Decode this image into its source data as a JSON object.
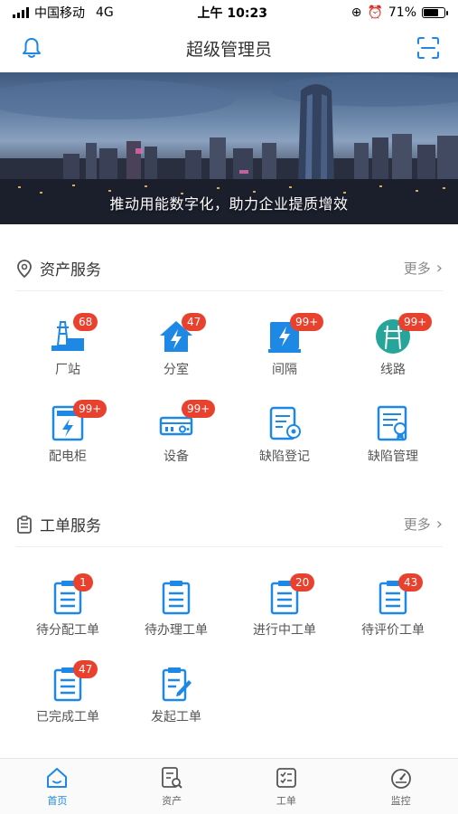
{
  "status_bar": {
    "carrier": "中国移动",
    "network": "4G",
    "time": "上午 10:23",
    "battery": "71%",
    "battery_level": 0.71
  },
  "header": {
    "title": "超级管理员"
  },
  "banner": {
    "caption": "推动用能数字化，助力企业提质增效"
  },
  "asset_section": {
    "title": "资产服务",
    "more": "更多",
    "items": [
      {
        "label": "厂站",
        "badge": "68",
        "icon": "substation-icon"
      },
      {
        "label": "分室",
        "badge": "47",
        "icon": "room-icon"
      },
      {
        "label": "间隔",
        "badge": "99+",
        "icon": "bay-icon"
      },
      {
        "label": "线路",
        "badge": "99+",
        "icon": "line-icon"
      },
      {
        "label": "配电柜",
        "badge": "99+",
        "icon": "cabinet-icon"
      },
      {
        "label": "设备",
        "badge": "99+",
        "icon": "device-icon"
      },
      {
        "label": "缺陷登记",
        "badge": "",
        "icon": "defect-register-icon"
      },
      {
        "label": "缺陷管理",
        "badge": "",
        "icon": "defect-manage-icon"
      }
    ]
  },
  "work_section": {
    "title": "工单服务",
    "more": "更多",
    "items": [
      {
        "label": "待分配工单",
        "badge": "1"
      },
      {
        "label": "待办理工单",
        "badge": ""
      },
      {
        "label": "进行中工单",
        "badge": "20"
      },
      {
        "label": "待评价工单",
        "badge": "43"
      },
      {
        "label": "已完成工单",
        "badge": "47"
      },
      {
        "label": "发起工单",
        "badge": ""
      }
    ]
  },
  "tabbar": {
    "items": [
      {
        "label": "首页",
        "active": true
      },
      {
        "label": "资产",
        "active": false
      },
      {
        "label": "工单",
        "active": false
      },
      {
        "label": "监控",
        "active": false
      }
    ]
  },
  "colors": {
    "accent": "#1e88e5",
    "badge": "#e8412e",
    "teal": "#26a69a"
  }
}
